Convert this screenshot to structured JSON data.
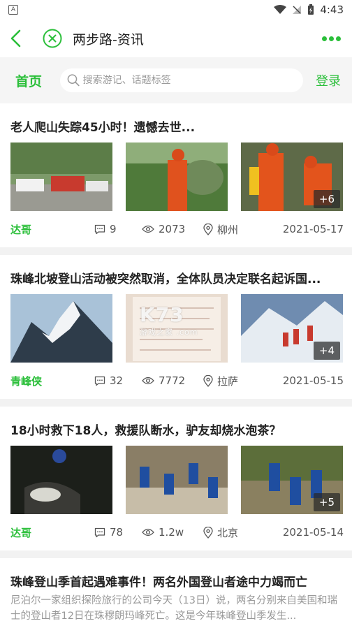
{
  "status_bar": {
    "time": "4:43",
    "app_icon_letter": "A"
  },
  "nav": {
    "title": "两步路-资讯"
  },
  "search": {
    "home": "首页",
    "placeholder": "搜索游记、话题标签",
    "login": "登录"
  },
  "accent_color": "#2bbf3a",
  "articles": [
    {
      "title": "老人爬山失踪45小时！遗憾去世...",
      "more_images": "+6",
      "author": "达哥",
      "comments": "9",
      "views": "2073",
      "location": "柳州",
      "date": "2021-05-17"
    },
    {
      "title": "珠峰北坡登山活动被突然取消，全体队员决定联名起诉国...",
      "more_images": "+4",
      "author": "青峰侠",
      "comments": "32",
      "views": "7772",
      "location": "拉萨",
      "date": "2021-05-15"
    },
    {
      "title": "18小时救下18人，救援队断水，驴友却烧水泡茶？",
      "more_images": "+5",
      "author": "达哥",
      "comments": "78",
      "views": "1.2w",
      "location": "北京",
      "date": "2021-05-14"
    },
    {
      "title": "珠峰登山季首起遇难事件！两名外国登山者途中力竭而亡",
      "summary": "尼泊尔一家组织探险旅行的公司今天（13日）说，两名分别来自美国和瑞士的登山者12日在珠穆朗玛峰死亡。这是今年珠峰登山季发生..."
    }
  ],
  "watermark": {
    "brand": "K73",
    "sub": "游戏之家 .com"
  },
  "icons": {
    "back": "chevron-left-icon",
    "close": "circle-x-icon",
    "more": "three-dots-icon",
    "search": "search-icon",
    "comments": "comment-icon",
    "views": "eye-icon",
    "location": "location-pin-icon"
  }
}
